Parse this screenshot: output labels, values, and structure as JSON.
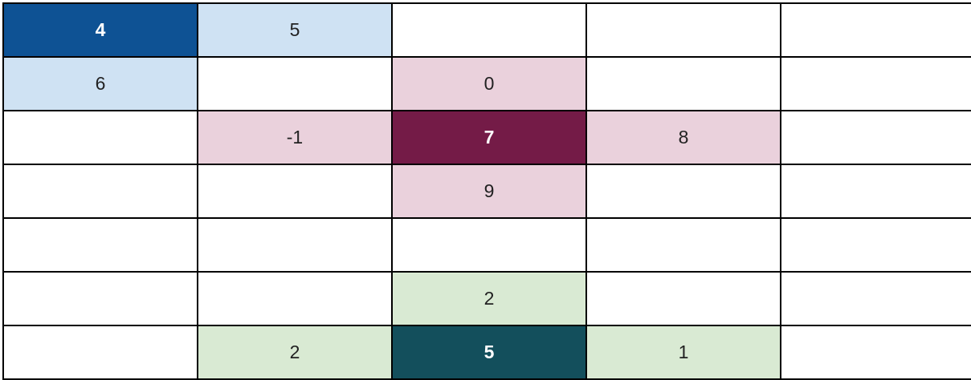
{
  "grid": {
    "rows": [
      [
        {
          "value": "4",
          "bg": "#0e5294",
          "bold": true
        },
        {
          "value": "5",
          "bg": "#cfe2f3",
          "bold": false
        },
        {
          "value": "",
          "bg": "#ffffff",
          "bold": false
        },
        {
          "value": "",
          "bg": "#ffffff",
          "bold": false
        },
        {
          "value": "",
          "bg": "#ffffff",
          "bold": false
        }
      ],
      [
        {
          "value": "6",
          "bg": "#cfe2f3",
          "bold": false
        },
        {
          "value": "",
          "bg": "#ffffff",
          "bold": false
        },
        {
          "value": "0",
          "bg": "#ead1dc",
          "bold": false
        },
        {
          "value": "",
          "bg": "#ffffff",
          "bold": false
        },
        {
          "value": "",
          "bg": "#ffffff",
          "bold": false
        }
      ],
      [
        {
          "value": "",
          "bg": "#ffffff",
          "bold": false
        },
        {
          "value": "-1",
          "bg": "#ead1dc",
          "bold": false
        },
        {
          "value": "7",
          "bg": "#741b47",
          "bold": true
        },
        {
          "value": "8",
          "bg": "#ead1dc",
          "bold": false
        },
        {
          "value": "",
          "bg": "#ffffff",
          "bold": false
        }
      ],
      [
        {
          "value": "",
          "bg": "#ffffff",
          "bold": false
        },
        {
          "value": "",
          "bg": "#ffffff",
          "bold": false
        },
        {
          "value": "9",
          "bg": "#ead1dc",
          "bold": false
        },
        {
          "value": "",
          "bg": "#ffffff",
          "bold": false
        },
        {
          "value": "",
          "bg": "#ffffff",
          "bold": false
        }
      ],
      [
        {
          "value": "",
          "bg": "#ffffff",
          "bold": false
        },
        {
          "value": "",
          "bg": "#ffffff",
          "bold": false
        },
        {
          "value": "",
          "bg": "#ffffff",
          "bold": false
        },
        {
          "value": "",
          "bg": "#ffffff",
          "bold": false
        },
        {
          "value": "",
          "bg": "#ffffff",
          "bold": false
        }
      ],
      [
        {
          "value": "",
          "bg": "#ffffff",
          "bold": false
        },
        {
          "value": "",
          "bg": "#ffffff",
          "bold": false
        },
        {
          "value": "2",
          "bg": "#d9ead3",
          "bold": false
        },
        {
          "value": "",
          "bg": "#ffffff",
          "bold": false
        },
        {
          "value": "",
          "bg": "#ffffff",
          "bold": false
        }
      ],
      [
        {
          "value": "",
          "bg": "#ffffff",
          "bold": false
        },
        {
          "value": "2",
          "bg": "#d9ead3",
          "bold": false
        },
        {
          "value": "5",
          "bg": "#134f5c",
          "bold": true
        },
        {
          "value": "1",
          "bg": "#d9ead3",
          "bold": false
        },
        {
          "value": "",
          "bg": "#ffffff",
          "bold": false
        }
      ]
    ]
  }
}
